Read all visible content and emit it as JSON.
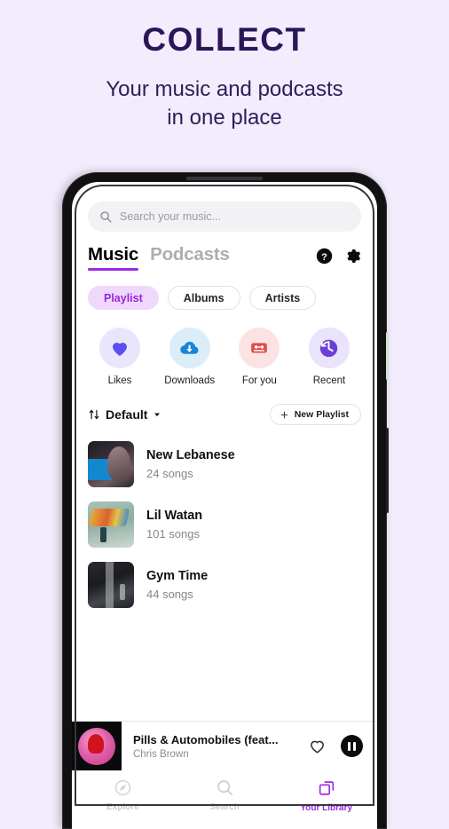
{
  "promo": {
    "title": "COLLECT",
    "subtitle_line1": "Your music and podcasts",
    "subtitle_line2": "in one place",
    "title_color": "#2a1657"
  },
  "theme": {
    "page_background": "#f3ecfd",
    "accent_purple": "#9a2be6",
    "chip_active_bg": "#eed9fb",
    "chip_active_text": "#9a23e0",
    "likes_color": "#5a4ef0",
    "downloads_color": "#1a85d6",
    "foryou_color": "#e04b4b",
    "recent_color": "#6b3fd4"
  },
  "search": {
    "placeholder": "Search your music...",
    "value": "",
    "icon": "search-icon"
  },
  "tabs": [
    {
      "label": "Music",
      "active": true
    },
    {
      "label": "Podcasts",
      "active": false
    }
  ],
  "header_icons": [
    {
      "name": "help-icon",
      "label": "?"
    },
    {
      "name": "settings-gear-icon",
      "label": ""
    }
  ],
  "chips": [
    {
      "label": "Playlist",
      "active": true
    },
    {
      "label": "Albums",
      "active": false
    },
    {
      "label": "Artists",
      "active": false
    }
  ],
  "quick_actions": [
    {
      "label": "Likes",
      "icon": "heart-icon",
      "icon_color": "#5a4ef0",
      "circle_color": "#e9e6fb"
    },
    {
      "label": "Downloads",
      "icon": "download-cloud-icon",
      "icon_color": "#1a85d6",
      "circle_color": "#dcedfa"
    },
    {
      "label": "For you",
      "icon": "cassette-icon",
      "icon_color": "#e04b4b",
      "circle_color": "#fbe3e4"
    },
    {
      "label": "Recent",
      "icon": "history-clock-icon",
      "icon_color": "#6b3fd4",
      "circle_color": "#e9e3fb"
    }
  ],
  "sort": {
    "label": "Default",
    "sort_icon": "sort-arrows-icon",
    "chevron_icon": "chevron-down-icon"
  },
  "new_playlist_button": {
    "label": "New Playlist",
    "icon": "plus-icon"
  },
  "playlists": [
    {
      "title": "New Lebanese",
      "songs": "24 songs",
      "art": "art-leb"
    },
    {
      "title": "Lil Watan",
      "songs": "101 songs",
      "art": "art-wat"
    },
    {
      "title": "Gym Time",
      "songs": "44 songs",
      "art": "art-gym"
    }
  ],
  "now_playing": {
    "title": "Pills & Automobiles (feat...",
    "artist": "Chris Brown",
    "like_icon": "heart-outline-icon",
    "play_state_icon": "pause-icon"
  },
  "bottom_nav": [
    {
      "label": "Explore",
      "icon": "compass-icon",
      "active": false
    },
    {
      "label": "Search",
      "icon": "search-icon",
      "active": false
    },
    {
      "label": "Your Library",
      "icon": "library-stack-icon",
      "active": true
    }
  ]
}
